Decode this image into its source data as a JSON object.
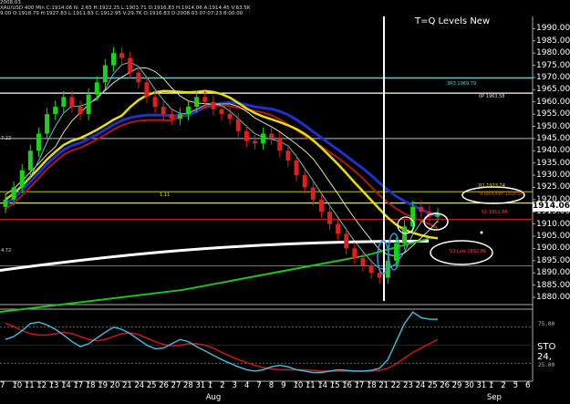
{
  "header": {
    "line1": "2008:03",
    "line2": "XAU/USD  400 Min  C:1914.06  N:  2.65  H:1922.25  L:1903.71  O:1916.83  H:1914.06  A:1914.45  V:63.5K",
    "line3": "9.00  O:1918.79  H:1927.83  L:1911.83  C:1912.95  V:29.7K  O:1916.83  D:2008.03  07:07:23  8:00:00"
  },
  "title": "T=Q Levels New",
  "current_price": "1914.06",
  "level_labels": {
    "r3": "3R3 1969.79",
    "pp": "0P 1963.58",
    "r1": "R1 1923.24",
    "rollover": "9 RollOver 1918.56",
    "s1": "S1 1911.86",
    "s3": "S3 Low 1892.86",
    "left_top": "7.22",
    "left_mid": "1.11",
    "left_low": "4.72"
  },
  "oscillator": {
    "label": "STO 24,",
    "upper": "75.00",
    "lower": "25.00"
  },
  "chart_data": {
    "type": "candlestick",
    "symbol": "XAU/USD",
    "timeframe": "400 Min",
    "y_ticks": [
      1880,
      1885,
      1890,
      1895,
      1900,
      1905,
      1910,
      1915,
      1920,
      1925,
      1930,
      1935,
      1940,
      1945,
      1950,
      1955,
      1960,
      1965,
      1970,
      1975,
      1980,
      1985,
      1990
    ],
    "ylim": [
      1877,
      1995
    ],
    "x_ticks": [
      "7",
      "10",
      "11",
      "12",
      "13",
      "14",
      "17",
      "18",
      "19",
      "20",
      "21",
      "24",
      "25",
      "26",
      "27",
      "28",
      "31",
      "1",
      "2",
      "3",
      "4",
      "7",
      "8",
      "9",
      "10",
      "11",
      "14",
      "15",
      "16",
      "17",
      "18",
      "21",
      "22",
      "23",
      "24",
      "25",
      "26",
      "29",
      "30",
      "31",
      "1",
      "2",
      "5",
      "6"
    ],
    "month_labels": [
      {
        "label": "Aug",
        "at_tick": 17
      },
      {
        "label": "Sep",
        "at_tick": 40
      }
    ],
    "close_path": [
      1920,
      1925,
      1932,
      1940,
      1947,
      1955,
      1958,
      1962,
      1958,
      1955,
      1963,
      1968,
      1975,
      1980,
      1978,
      1972,
      1968,
      1962,
      1958,
      1955,
      1953,
      1955,
      1958,
      1962,
      1960,
      1957,
      1955,
      1953,
      1948,
      1944,
      1943,
      1947,
      1945,
      1940,
      1936,
      1930,
      1925,
      1920,
      1915,
      1910,
      1906,
      1900,
      1896,
      1893,
      1890,
      1888,
      1895,
      1902,
      1909,
      1917,
      1915,
      1913,
      1914
    ],
    "horizontal_levels": [
      1969.79,
      1963.58,
      1945,
      1923.24,
      1918.56,
      1911.86,
      1892.86
    ],
    "oscillator_ylim": [
      0,
      100
    ],
    "oscillator_levels": [
      75,
      25
    ],
    "colors": {
      "bull": "#18d418",
      "bear": "#e02020",
      "ma_yellow": "#e8e000",
      "ma_blue": "#2030c8",
      "ma_red": "#b01818",
      "ma_white": "#ffffff",
      "ma_green": "#20c020",
      "ma_cyan": "#60c0c0",
      "r3": "#30e0e0",
      "s1": "#e02020",
      "sto_k": "#40c0e0",
      "sto_d": "#c01818"
    }
  }
}
